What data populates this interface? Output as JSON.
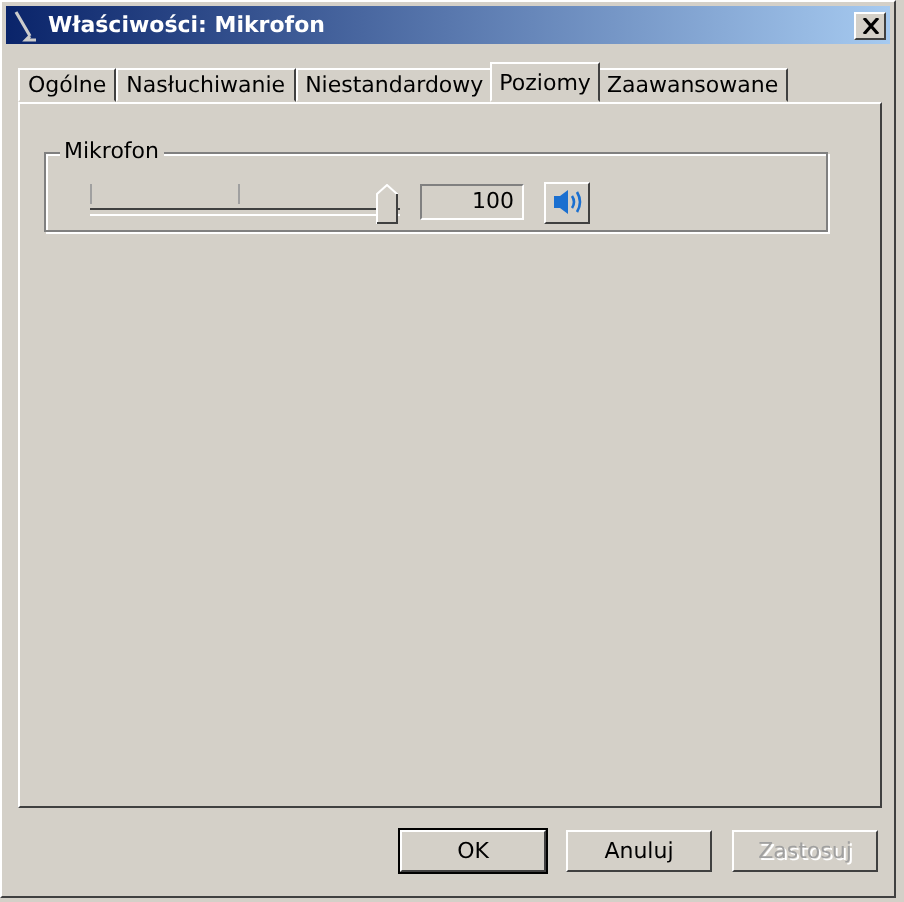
{
  "window": {
    "title": "Właściwości: Mikrofon"
  },
  "tabs": [
    {
      "label": "Ogólne",
      "selected": false
    },
    {
      "label": "Nasłuchiwanie",
      "selected": false
    },
    {
      "label": "Niestandardowy",
      "selected": false
    },
    {
      "label": "Poziomy",
      "selected": true
    },
    {
      "label": "Zaawansowane",
      "selected": false
    }
  ],
  "group": {
    "label": "Mikrofon",
    "level": 1,
    "reading": "100",
    "muted": false
  },
  "buttons": [
    {
      "label": "OK",
      "default": true,
      "disabled": false
    },
    {
      "label": "Anuluj",
      "default": false,
      "disabled": false
    },
    {
      "label": "Zastosuj",
      "default": false,
      "disabled": true
    }
  ]
}
